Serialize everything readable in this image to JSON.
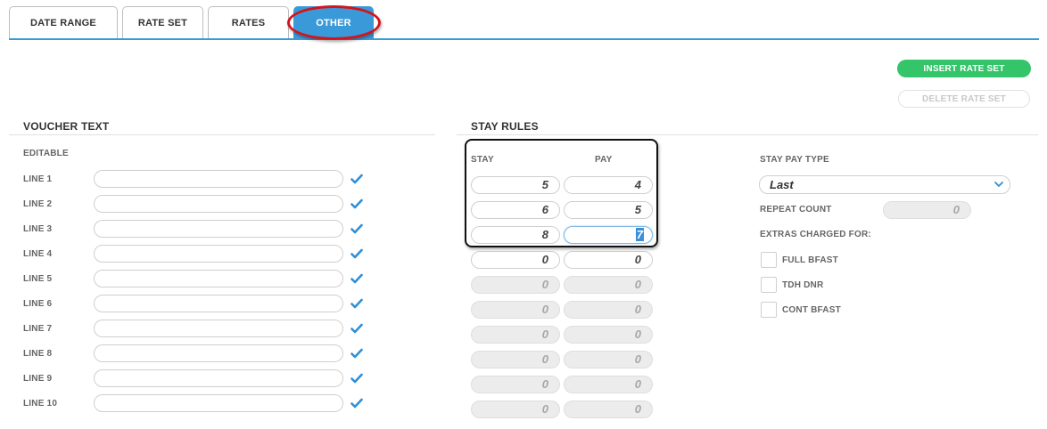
{
  "tabs": [
    {
      "label": "DATE RANGE",
      "active": false
    },
    {
      "label": "RATE SET",
      "active": false
    },
    {
      "label": "RATES",
      "active": false
    },
    {
      "label": "OTHER",
      "active": true
    }
  ],
  "actions": {
    "insert_label": "INSERT RATE SET",
    "delete_label": "DELETE RATE SET"
  },
  "voucher": {
    "title": "VOUCHER TEXT",
    "editable_label": "EDITABLE",
    "lines": [
      {
        "label": "LINE 1",
        "value": "",
        "checked": true
      },
      {
        "label": "LINE 2",
        "value": "",
        "checked": true
      },
      {
        "label": "LINE 3",
        "value": "",
        "checked": true
      },
      {
        "label": "LINE 4",
        "value": "",
        "checked": true
      },
      {
        "label": "LINE 5",
        "value": "",
        "checked": true
      },
      {
        "label": "LINE 6",
        "value": "",
        "checked": true
      },
      {
        "label": "LINE 7",
        "value": "",
        "checked": true
      },
      {
        "label": "LINE 8",
        "value": "",
        "checked": true
      },
      {
        "label": "LINE 9",
        "value": "",
        "checked": true
      },
      {
        "label": "LINE 10",
        "value": "",
        "checked": true
      }
    ]
  },
  "stay_rules": {
    "title": "STAY RULES",
    "stay_header": "STAY",
    "pay_header": "PAY",
    "rows": [
      {
        "stay": "5",
        "pay": "4",
        "enabled": true
      },
      {
        "stay": "6",
        "pay": "5",
        "enabled": true
      },
      {
        "stay": "8",
        "pay": "7",
        "enabled": true
      },
      {
        "stay": "0",
        "pay": "0",
        "enabled": true
      },
      {
        "stay": "0",
        "pay": "0",
        "enabled": false
      },
      {
        "stay": "0",
        "pay": "0",
        "enabled": false
      },
      {
        "stay": "0",
        "pay": "0",
        "enabled": false
      },
      {
        "stay": "0",
        "pay": "0",
        "enabled": false
      },
      {
        "stay": "0",
        "pay": "0",
        "enabled": false
      },
      {
        "stay": "0",
        "pay": "0",
        "enabled": false
      }
    ]
  },
  "stay_pay": {
    "type_label": "STAY PAY TYPE",
    "type_value": "Last",
    "repeat_label": "REPEAT COUNT",
    "repeat_value": "0",
    "extras_label": "EXTRAS CHARGED FOR:",
    "extras": [
      {
        "label": "FULL BFAST",
        "checked": false
      },
      {
        "label": "TDH DNR",
        "checked": false
      },
      {
        "label": "CONT BFAST",
        "checked": false
      }
    ]
  },
  "colors": {
    "accent": "#3a9ad9",
    "insert_green": "#34c46a",
    "highlight_red": "#d4141c",
    "check_blue": "#2f8fd8"
  },
  "icons": {
    "check": "check-icon",
    "select_arrow": "chevron-down-icon"
  }
}
